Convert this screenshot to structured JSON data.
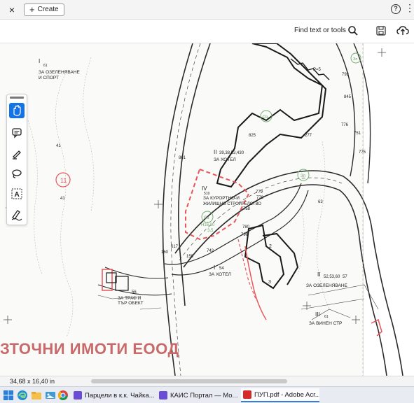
{
  "topbar": {
    "close_label": "×",
    "create_label": "Create",
    "help_label": "?",
    "more_label": "⋮"
  },
  "toolbar": {
    "find_label": "Find text or tools",
    "icons": [
      "search-icon",
      "save-icon",
      "upload-share-icon"
    ]
  },
  "tools": {
    "items": [
      "hand-icon",
      "comment-icon",
      "highlight-pen-icon",
      "lasso-draw-icon",
      "text-select-icon",
      "sign-icon"
    ],
    "active": "hand-icon"
  },
  "map": {
    "labels": {
      "zone_top_left_num": "I",
      "zone_top_left_small": "61",
      "zone_top_left_1": "ЗА ОЗЕЛЕНЯВАНЕ",
      "zone_top_left_2": "И СПОРТ",
      "circle_11": "11",
      "num_41": "41",
      "hotel_top_num": "II",
      "hotel_top_ids": "39,38,53,430",
      "hotel_top_label": "ЗА ХОТЕЛ",
      "n_825": "825",
      "n_277": "277",
      "n_776": "776",
      "n_751": "751",
      "n_775": "775",
      "n_793": "793",
      "n_845": "845",
      "n_861": "861",
      "n_787": "787",
      "n_57": "57",
      "n_63": "63",
      "n_41b": "41",
      "resort_num": "IV",
      "resort_small": "519",
      "resort_1": "ЗА КУРОРТНО-И",
      "resort_2": "ЖИЛИЩНО СТРОИТЕЛСТВО",
      "n_779": "779",
      "n_778": "778",
      "n_758": "758",
      "n_780": "780",
      "n_796": "796",
      "n_159": "159",
      "n_742": "742",
      "n_617": "617",
      "n_160": "160",
      "hotel_mid_num": "I",
      "hotel_mid_small": "54",
      "hotel_mid_label": "ЗА ХОТЕЛ",
      "building_2": "2",
      "building_3": "3",
      "green_num": "II",
      "green_ids": "52,53,60",
      "green_small": "57",
      "green_label": "ЗА ОЗЕЛЕНЯВАНЕ",
      "wine_num": "III",
      "wine_small": "61",
      "wine_label": "ЗА ВИНЕН СТР",
      "left_obj_1": "ЗА ТРАФ И",
      "left_obj_2": "ТЪР ОБЕКТ",
      "left_obj_num": "56",
      "circle_oz": "Оз",
      "circle_zp": "Зп",
      "circle_oz2": "Оз",
      "circle_zp2": "Зп",
      "pua": "Р=5",
      "dim_box": "Н16,30",
      "dim_box2": "3,5"
    },
    "watermark": "ЗТОЧНИ ИМОТИ ЕООД",
    "colors": {
      "red_boundary": "#e8565c",
      "watermark": "#c96a6a",
      "map_lines": "#2b2b2b",
      "green": "#6aa86a"
    }
  },
  "status": {
    "dimensions": "34,68 x 16,40 in"
  },
  "taskbar": {
    "items": [
      {
        "label": "Парцели в к.к. Чайка...",
        "app": "firefox"
      },
      {
        "label": "КАИС Портал — Мо...",
        "app": "firefox"
      },
      {
        "label": "ПУП.pdf - Adobe Acr...",
        "app": "acrobat"
      }
    ]
  }
}
